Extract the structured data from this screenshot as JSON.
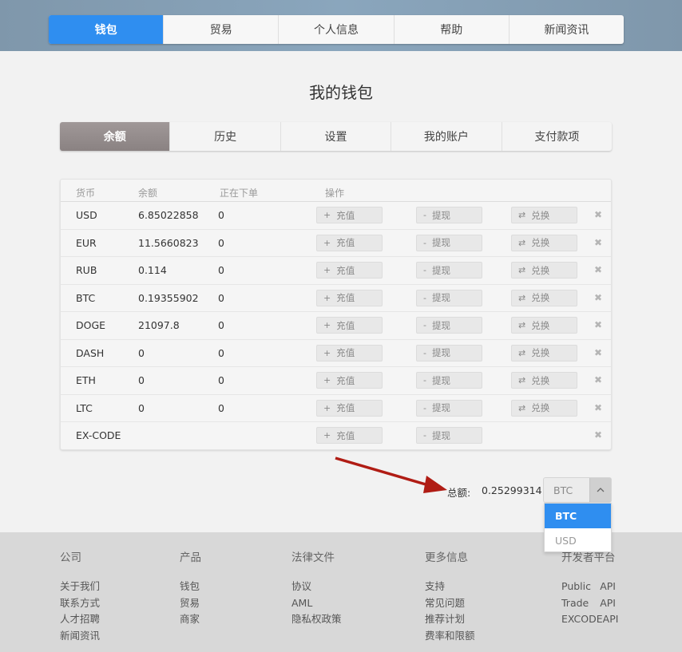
{
  "topnav": {
    "items": [
      {
        "label": "钱包",
        "active": true
      },
      {
        "label": "贸易",
        "active": false
      },
      {
        "label": "个人信息",
        "active": false
      },
      {
        "label": "帮助",
        "active": false
      },
      {
        "label": "新闻资讯",
        "active": false
      }
    ]
  },
  "page_title": "我的钱包",
  "subtabs": {
    "items": [
      {
        "label": "余额",
        "active": true
      },
      {
        "label": "历史",
        "active": false
      },
      {
        "label": "设置",
        "active": false
      },
      {
        "label": "我的账户",
        "active": false
      },
      {
        "label": "支付款项",
        "active": false
      }
    ]
  },
  "table": {
    "headers": {
      "currency": "货币",
      "balance": "余额",
      "in_orders": "正在下单",
      "actions": "操作"
    },
    "deposit_label": "充值",
    "withdraw_label": "提现",
    "exchange_label": "兑换",
    "rows": [
      {
        "currency": "USD",
        "balance": "6.85022858",
        "in_orders": "0",
        "exchange": true
      },
      {
        "currency": "EUR",
        "balance": "11.5660823",
        "in_orders": "0",
        "exchange": true
      },
      {
        "currency": "RUB",
        "balance": "0.114",
        "in_orders": "0",
        "exchange": true
      },
      {
        "currency": "BTC",
        "balance": "0.19355902",
        "in_orders": "0",
        "exchange": true
      },
      {
        "currency": "DOGE",
        "balance": "21097.8",
        "in_orders": "0",
        "exchange": true
      },
      {
        "currency": "DASH",
        "balance": "0",
        "in_orders": "0",
        "exchange": true
      },
      {
        "currency": "ETH",
        "balance": "0",
        "in_orders": "0",
        "exchange": true
      },
      {
        "currency": "LTC",
        "balance": "0",
        "in_orders": "0",
        "exchange": true
      },
      {
        "currency": "EX-CODE",
        "balance": "",
        "in_orders": "",
        "exchange": false
      }
    ]
  },
  "total": {
    "label": "总额:",
    "value": "0.25299314",
    "selected": "BTC",
    "options": [
      "BTC",
      "USD"
    ]
  },
  "colors": {
    "accent": "#2f8ef0",
    "annotation_arrow": "#b01c14"
  },
  "footer": {
    "company": {
      "title": "公司",
      "links": [
        "关于我们",
        "联系方式",
        "人才招聘",
        "新闻资讯"
      ]
    },
    "products": {
      "title": "产品",
      "links": [
        "钱包",
        "贸易",
        "商家"
      ]
    },
    "legal": {
      "title": "法律文件",
      "links": [
        "协议",
        "AML",
        "隐私权政策"
      ]
    },
    "more": {
      "title": "更多信息",
      "links": [
        "支持",
        "常见问题",
        "推荐计划",
        "费率和限额"
      ]
    },
    "dev": {
      "title": "开发者平台",
      "links": [
        {
          "name": "Public",
          "api": "API"
        },
        {
          "name": "Trade",
          "api": "API"
        },
        {
          "name": "EXCODE",
          "api": "API"
        }
      ]
    }
  }
}
